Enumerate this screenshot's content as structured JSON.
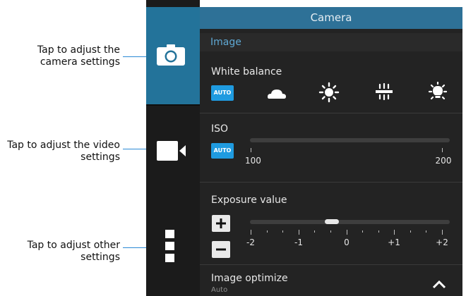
{
  "callouts": {
    "camera": [
      "Tap to adjust the",
      "camera settings"
    ],
    "video": [
      "Tap to adjust the video",
      "settings"
    ],
    "other": [
      "Tap to adjust other",
      "settings"
    ]
  },
  "sidebar": {
    "items": [
      {
        "name": "camera",
        "icon": "camera-icon",
        "active": true
      },
      {
        "name": "video",
        "icon": "video-camera-icon",
        "active": false
      },
      {
        "name": "other",
        "icon": "more-icon",
        "active": false
      }
    ]
  },
  "panel": {
    "title": "Camera",
    "section": "Image",
    "white_balance": {
      "label": "White balance",
      "auto": "AUTO",
      "options": [
        "auto",
        "cloudy-icon",
        "sunny-icon",
        "fluorescent-icon",
        "incandescent-icon"
      ]
    },
    "iso": {
      "label": "ISO",
      "auto": "AUTO",
      "min_label": "100",
      "max_label": "200"
    },
    "exposure": {
      "label": "Exposure value",
      "ticks": [
        "-2",
        "-1",
        "0",
        "+1",
        "+2"
      ],
      "value": -0.3,
      "range": [
        -2,
        2
      ]
    },
    "image_optimize": {
      "label": "Image optimize",
      "value": "Auto"
    }
  },
  "colors": {
    "accent": "#1f9be0",
    "callout_line": "#2b8ad6",
    "active_tab": "#23739a",
    "header": "#2e7197"
  }
}
